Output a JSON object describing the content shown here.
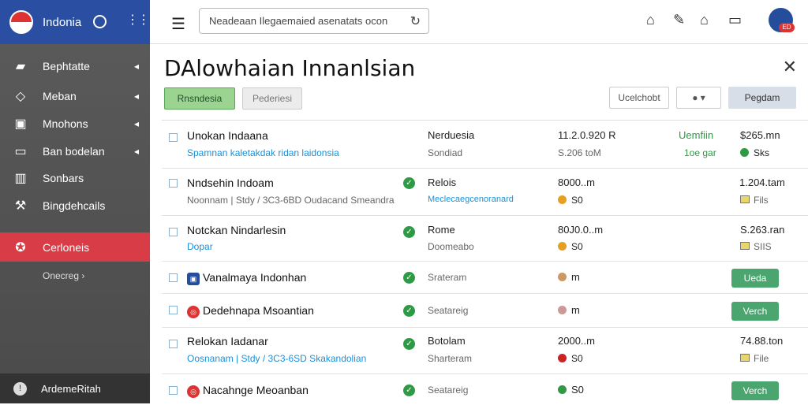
{
  "sidebar": {
    "brand": "Indonia",
    "items": [
      {
        "icon": "bank-icon",
        "label": "Bephtatte",
        "chevron": "◂"
      },
      {
        "icon": "diamond-icon",
        "label": "Meban",
        "chevron": "◂"
      },
      {
        "icon": "monitor-icon",
        "label": "Mnohons",
        "chevron": "◂"
      },
      {
        "icon": "card-icon",
        "label": "Ban bodelan",
        "chevron": "◂"
      },
      {
        "icon": "chart-icon",
        "label": "Sonbars",
        "chevron": ""
      },
      {
        "icon": "wrench-icon",
        "label": "Bingdehcails",
        "chevron": ""
      },
      {
        "icon": "star-icon",
        "label": "Cerloneis",
        "chevron": ""
      }
    ],
    "submenu": "Onecreg ›",
    "profile": "ArdemeRitah"
  },
  "topbar": {
    "search": "Neadeaan Ilegaemaied asenatats ocon",
    "avatar": "ED"
  },
  "main": {
    "title": "DAlowhaian Innanlsian",
    "tabs": [
      "Rnsndesia",
      "Pederiesi"
    ],
    "actions": [
      "Ucelchobt",
      "Pegdam"
    ],
    "rows": [
      {
        "title": "Unokan Indaana",
        "subtitle": "Spamnan  kaletakdak ridan laidonsia",
        "country": "Nerduesia",
        "sublabel": "Sondiad",
        "amount": "11.2.0.920 R",
        "amountsub": "S.206 toM",
        "status": "Uemfiin",
        "statussub": "1oe gar",
        "value": "$265.mn",
        "valuesub": "Sks",
        "check": false,
        "tag": ""
      },
      {
        "title": "Nndsehin Indoam",
        "subtitle": "Noonnam | Stdy / 3C3-6BD  Oudacand Smeandra",
        "country": "Relois",
        "sublabel": "Meclecaegcenoranard",
        "amount": "8000..m",
        "amountsub": "S0",
        "status": "",
        "statussub": "",
        "value": "1.204.tam",
        "valuesub": "Fils",
        "check": true,
        "tag": ""
      },
      {
        "title": "Notckan Nindarlesin",
        "subtitle": "Dopar",
        "country": "Rome",
        "sublabel": "Doomeabo",
        "amount": "80J0.0..m",
        "amountsub": "S0",
        "status": "",
        "statussub": "",
        "value": "S.263.ran",
        "valuesub": "SIIS",
        "check": true,
        "tag": ""
      },
      {
        "title": "Vanalmaya Indonhan",
        "subtitle": "",
        "country": "Srateram",
        "sublabel": "",
        "amount": "m",
        "amountsub": "",
        "status": "",
        "statussub": "",
        "value": "",
        "valuesub": "",
        "check": true,
        "tag": "Ueda"
      },
      {
        "title": "Dedehnapa Msoantian",
        "subtitle": "",
        "country": "Seatareig",
        "sublabel": "",
        "amount": "m",
        "amountsub": "",
        "status": "",
        "statussub": "",
        "value": "",
        "valuesub": "",
        "check": true,
        "tag": "Verch"
      },
      {
        "title": "Relokan Iadanar",
        "subtitle": "Oosnanam | Stdy / 3C3-6SD  Skakandolian",
        "country": "Botolam",
        "sublabel": "Sharteram",
        "amount": "2000..m",
        "amountsub": "S0",
        "status": "",
        "statussub": "",
        "value": "74.88.ton",
        "valuesub": "File",
        "check": true,
        "tag": ""
      },
      {
        "title": "Nacahnge Meoanban",
        "subtitle": "",
        "country": "Seatareig",
        "sublabel": "",
        "amount": "S0",
        "amountsub": "",
        "status": "",
        "statussub": "",
        "value": "",
        "valuesub": "",
        "check": true,
        "tag": "Verch"
      }
    ]
  },
  "colors": {
    "accent": "#2a4fa2",
    "active": "#d83d47",
    "success": "#2e9a45"
  }
}
